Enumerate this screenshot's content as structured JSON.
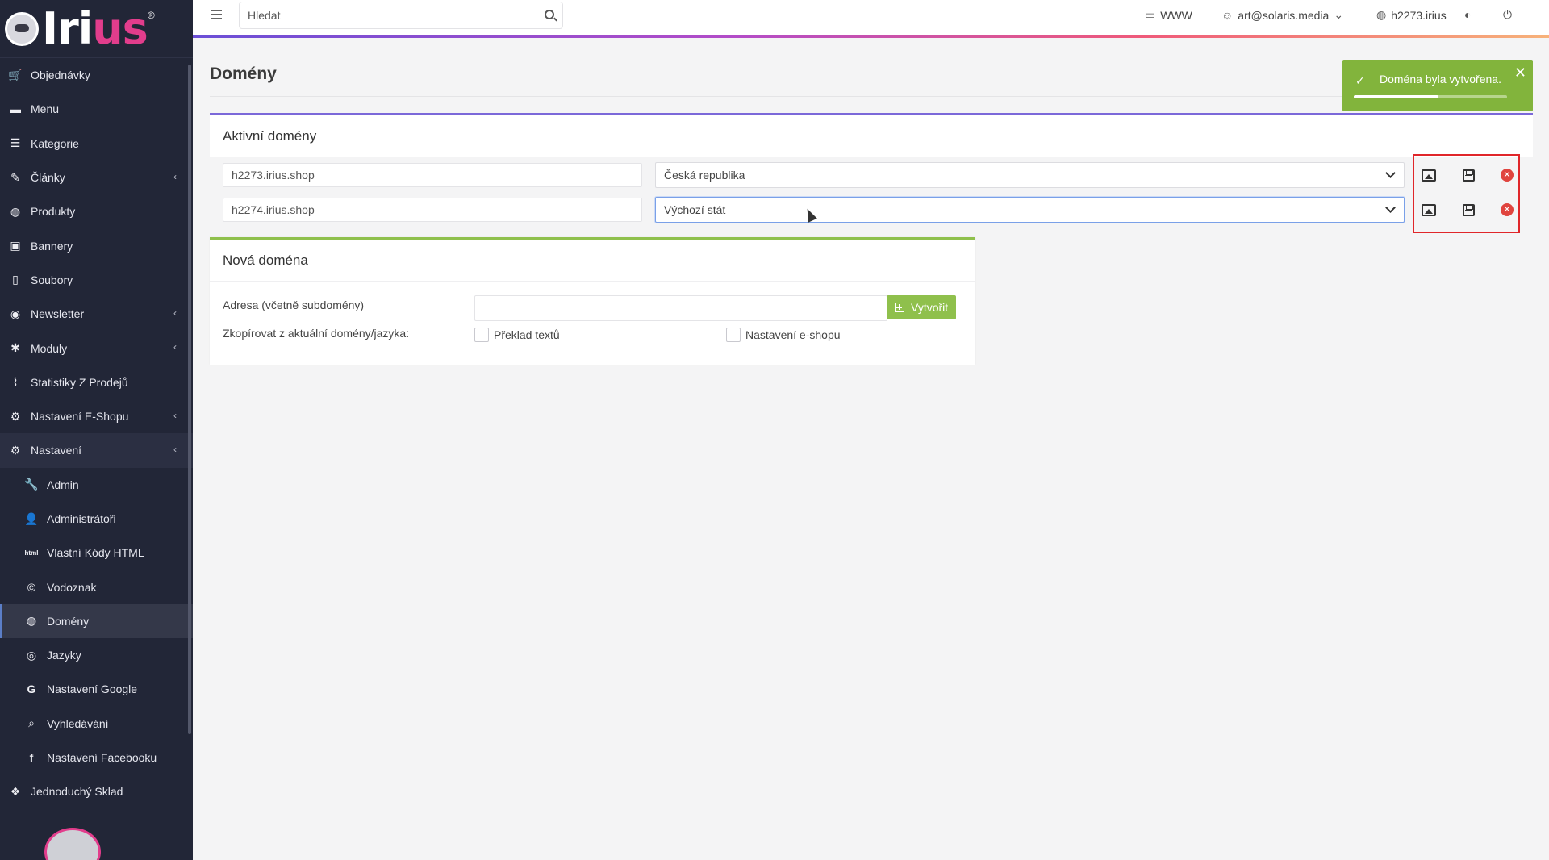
{
  "logo": {
    "text_main": "Iri",
    "text_accent": "us",
    "reg": "®"
  },
  "sidebar": {
    "items": [
      {
        "label": "Objednávky",
        "icon": "cart-icon",
        "glyph": "🛒"
      },
      {
        "label": "Menu",
        "icon": "folder-icon",
        "glyph": "▬"
      },
      {
        "label": "Kategorie",
        "icon": "list-icon",
        "glyph": "☰"
      },
      {
        "label": "Články",
        "icon": "pencil-icon",
        "glyph": "✎"
      },
      {
        "label": "Produkty",
        "icon": "globe-icon",
        "glyph": "◍"
      },
      {
        "label": "Bannery",
        "icon": "image-icon",
        "glyph": "▣"
      },
      {
        "label": "Soubory",
        "icon": "file-icon",
        "glyph": "▯"
      },
      {
        "label": "Newsletter",
        "icon": "newsletter-icon",
        "glyph": "◉"
      },
      {
        "label": "Moduly",
        "icon": "puzzle-icon",
        "glyph": "✱"
      },
      {
        "label": "Statistiky Z Prodejů",
        "icon": "chart-icon",
        "glyph": "⌇"
      },
      {
        "label": "Nastavení E-Shopu",
        "icon": "cogs-icon",
        "glyph": "⚙"
      },
      {
        "label": "Nastavení",
        "icon": "cogs-icon",
        "glyph": "⚙"
      }
    ],
    "sub_items": [
      {
        "label": "Admin",
        "icon": "wrench-icon",
        "glyph": "🔧"
      },
      {
        "label": "Administrátoři",
        "icon": "user-icon",
        "glyph": "👤"
      },
      {
        "label": "Vlastní Kódy HTML",
        "icon": "html-icon",
        "glyph": "html"
      },
      {
        "label": "Vodoznak",
        "icon": "copyright-icon",
        "glyph": "©"
      },
      {
        "label": "Domény",
        "icon": "globe-icon",
        "glyph": "◍"
      },
      {
        "label": "Jazyky",
        "icon": "language-icon",
        "glyph": "◎"
      },
      {
        "label": "Nastavení Google",
        "icon": "google-icon",
        "glyph": "G"
      },
      {
        "label": "Vyhledávání",
        "icon": "search-icon",
        "glyph": "⌕"
      },
      {
        "label": "Nastavení Facebooku",
        "icon": "facebook-icon",
        "glyph": "f"
      }
    ],
    "last_item": {
      "label": "Jednoduchý Sklad",
      "icon": "dropbox-icon",
      "glyph": "❖"
    }
  },
  "topbar": {
    "search_placeholder": "Hledat",
    "www_label": "WWW",
    "user_label": "art@solaris.media",
    "domain_label": "h2273.irius"
  },
  "page": {
    "title": "Domény"
  },
  "toast": {
    "message": "Doména byla vytvořena.",
    "check": "✓",
    "close": "✕",
    "progress": 0.55
  },
  "active_domains": {
    "heading": "Aktivní domény",
    "rows": [
      {
        "domain": "h2273.irius.shop",
        "country": "Česká republika"
      },
      {
        "domain": "h2274.irius.shop",
        "country": "Výchozí stát"
      }
    ],
    "delete_glyph": "✕"
  },
  "new_domain": {
    "heading": "Nová doména",
    "address_label": "Adresa (včetně subdomény)",
    "address_value": "",
    "create_button": "Vytvořit",
    "copy_label": "Zkopírovat z aktuální domény/jazyka:",
    "checkbox_texts": "Překlad textů",
    "checkbox_eshop": "Nastavení e-shopu"
  },
  "colors": {
    "sidebar_bg": "#222637",
    "accent_purple": "#7b68d9",
    "accent_green": "#8fc04c",
    "toast_green": "#82b43c",
    "delete_red": "#e0443e"
  }
}
